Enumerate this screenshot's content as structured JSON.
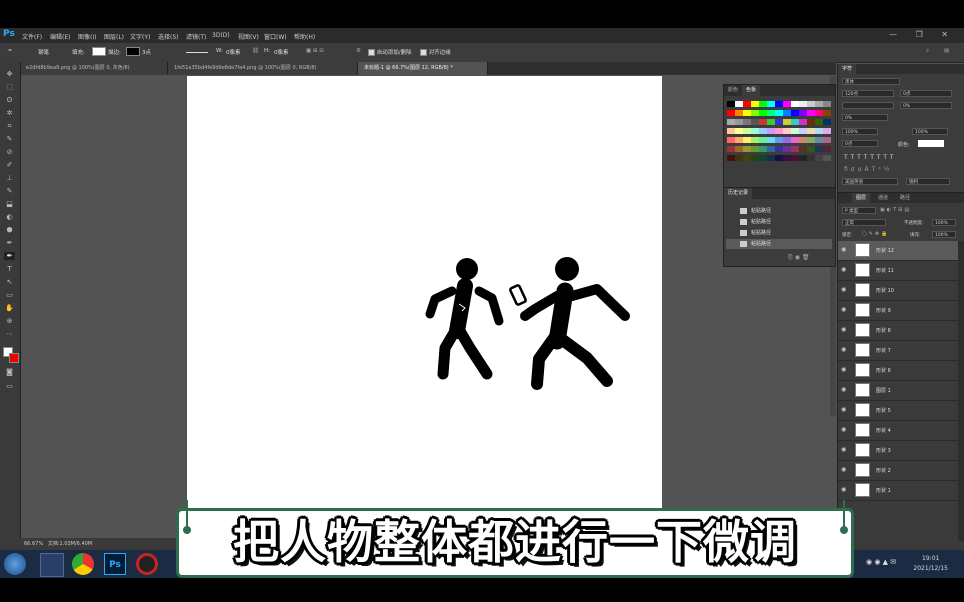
{
  "app": {
    "logo": "Ps",
    "window_controls": "— ❐ ✕"
  },
  "menu": [
    "文件(F)",
    "编辑(E)",
    "图像(I)",
    "图层(L)",
    "文字(Y)",
    "选择(S)",
    "滤镜(T)",
    "3D(D)",
    "视图(V)",
    "窗口(W)",
    "帮助(H)"
  ],
  "options": {
    "tool": "钢笔",
    "mode": "形状",
    "fill": "填充:",
    "stroke": "描边:",
    "stroke_w": "3点",
    "w": "W:",
    "w_val": "0像素",
    "h": "H:",
    "h_val": "0像素",
    "auto_label": "自动添加/删除",
    "align_label": "对齐边缘"
  },
  "tabs": [
    {
      "label": "e2dfd8b9ea9.png @ 100%(图层 0, 灰色/8)"
    },
    {
      "label": "1fe51a35bd4fe9d9e8de7fa4.png @ 100%(图层 0, RGB/8)"
    },
    {
      "label": "未标题-1 @ 66.7%(图层 12, RGB/8) *"
    }
  ],
  "tools": [
    "✥",
    "⬚",
    "ʘ",
    "✲",
    "⌗",
    "✎",
    "⊘",
    "✐",
    "⊥",
    "✎",
    "⬓",
    "◐",
    "⬢",
    "✒",
    "T",
    "↖",
    "▭",
    "✋",
    "⊕",
    "⋯"
  ],
  "swatches_panel": {
    "tab1": "颜色",
    "tab2": "色板"
  },
  "history_panel": {
    "tab": "历史记录",
    "items": [
      "粘贴路径",
      "粘贴路径",
      "粘贴路径",
      "粘贴路径"
    ]
  },
  "char_panel": {
    "tab": "字符",
    "font": "黑体",
    "size": "120点",
    "size2": "0点",
    "tracking": "0%",
    "scale_v": "100%",
    "scale_h": "100%",
    "baseline": "0点",
    "color_label": "颜色:",
    "lang": "美国英语",
    "aa": "锐利"
  },
  "layers_panel": {
    "tabs": [
      "图层",
      "通道",
      "路径"
    ],
    "kind": "P 类型",
    "blend": "正常",
    "opacity_label": "不透明度:",
    "opacity": "100%",
    "lock_label": "锁定:",
    "fill_label": "填充:",
    "fill": "100%",
    "layers": [
      "形状 12",
      "形状 11",
      "形状 10",
      "形状 9",
      "形状 8",
      "形状 7",
      "形状 6",
      "图层 1",
      "形状 5",
      "形状 4",
      "形状 3",
      "形状 2",
      "形状 1"
    ]
  },
  "status": {
    "zoom": "66.67%",
    "doc": "文档:1.03M/6.40M"
  },
  "clock": {
    "time": "19:01",
    "date": "2021/12/15"
  },
  "caption": "把人物整体都进行一下微调",
  "colors": {
    "accent": "#2d6e4e",
    "workspace": "#535353",
    "panel": "#3c3c3c"
  }
}
